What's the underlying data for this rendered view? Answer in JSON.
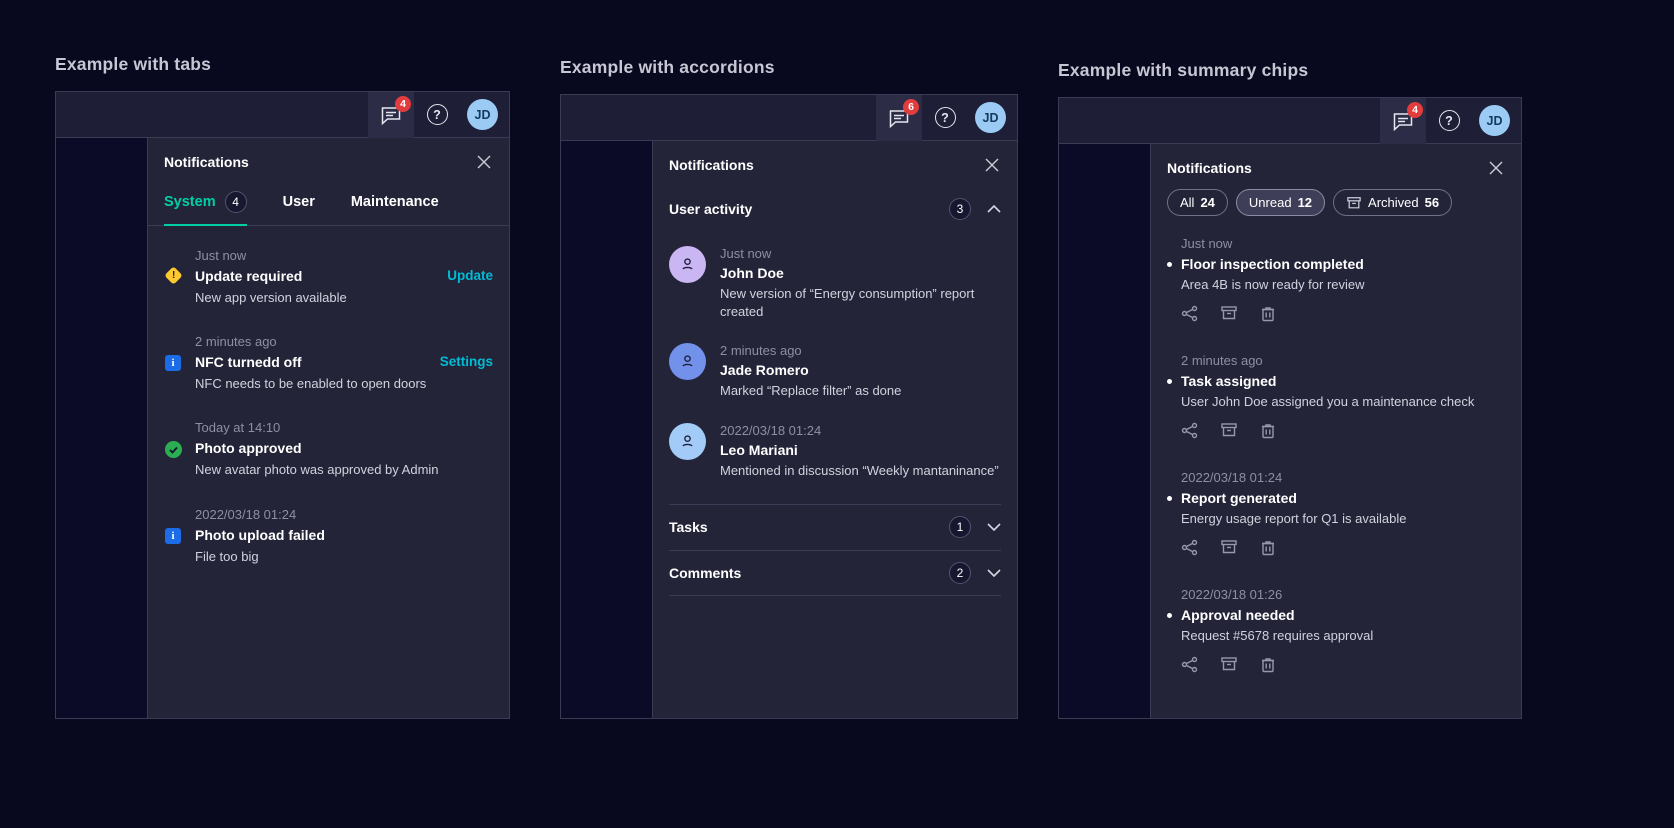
{
  "colors": {
    "page_background": "#08081f",
    "panel_background": "#242439",
    "titlebar_background": "#1e1e37",
    "accent_tab": "#00cfa6",
    "accent_link": "#00bcd4",
    "badge_red": "#e23c3c",
    "warning_yellow": "#fdc92e",
    "info_blue": "#1c6ce8",
    "success_green": "#2aae51",
    "avatar_blue": "#9bcbf5"
  },
  "icons": {
    "toolbar_message": "message-bubble-icon",
    "toolbar_help": "question-mark-icon",
    "close": "close-x-icon",
    "warning": "warning-diamond-icon",
    "info": "info-square-icon",
    "success": "check-circle-icon",
    "person": "person-icon",
    "chevron_up": "chevron-up-icon",
    "chevron_down": "chevron-down-icon",
    "share": "share-icon",
    "archive": "archive-icon",
    "trash": "trash-icon"
  },
  "sections": {
    "tabs": {
      "title": "Example with tabs",
      "toolbar": {
        "message_badge": "4",
        "help_label": "?",
        "avatar": "JD"
      },
      "panel": {
        "title": "Notifications",
        "tabs": [
          {
            "label": "System",
            "count": "4"
          },
          {
            "label": "User"
          },
          {
            "label": "Maintenance"
          }
        ],
        "items": [
          {
            "icon": "warning",
            "time": "Just now",
            "title": "Update required",
            "desc": "New app version available",
            "action": "Update"
          },
          {
            "icon": "info",
            "time": "2 minutes ago",
            "title": "NFC turnedd off",
            "desc": "NFC needs to be enabled to open doors",
            "action": "Settings"
          },
          {
            "icon": "success",
            "time": "Today at 14:10",
            "title": "Photo approved",
            "desc": "New avatar photo was approved by Admin"
          },
          {
            "icon": "info",
            "time": "2022/03/18 01:24",
            "title": "Photo upload failed",
            "desc": "File too big"
          }
        ],
        "info_glyph": "i",
        "warning_glyph": "!"
      }
    },
    "accordions": {
      "title": "Example with accordions",
      "toolbar": {
        "message_badge": "6",
        "help_label": "?",
        "avatar": "JD"
      },
      "panel": {
        "title": "Notifications",
        "groups": [
          {
            "label": "User activity",
            "count": "3",
            "expanded": true
          },
          {
            "label": "Tasks",
            "count": "1",
            "expanded": false
          },
          {
            "label": "Comments",
            "count": "2",
            "expanded": false
          }
        ],
        "activity_items": [
          {
            "avatar_color": "#c9b6f2",
            "time": "Just now",
            "name": "John Doe",
            "desc": "New version of “Energy consumption” report created"
          },
          {
            "avatar_color": "#7191ea",
            "time": "2 minutes ago",
            "name": "Jade Romero",
            "desc": "Marked “Replace filter” as done"
          },
          {
            "avatar_color": "#a3cbf7",
            "time": "2022/03/18 01:24",
            "name": "Leo Mariani",
            "desc": "Mentioned in discussion “Weekly mantaninance”"
          }
        ]
      }
    },
    "chips": {
      "title": "Example with summary chips",
      "toolbar": {
        "message_badge": "4",
        "help_label": "?",
        "avatar": "JD"
      },
      "panel": {
        "title": "Notifications",
        "chips": [
          {
            "label": "All",
            "count": "24",
            "selected": false
          },
          {
            "label": "Unread",
            "count": "12",
            "selected": true
          },
          {
            "label": "Archived",
            "count": "56",
            "selected": false,
            "icon": "archive"
          }
        ],
        "items": [
          {
            "time": "Just now",
            "title": "Floor inspection completed",
            "desc": "Area 4B is now ready for review"
          },
          {
            "time": "2 minutes ago",
            "title": "Task assigned",
            "desc": "User John Doe assigned you a maintenance check"
          },
          {
            "time": "2022/03/18 01:24",
            "title": "Report generated",
            "desc": "Energy usage report for Q1 is available"
          },
          {
            "time": "2022/03/18 01:26",
            "title": "Approval needed",
            "desc": "Request #5678 requires approval"
          }
        ]
      }
    }
  }
}
